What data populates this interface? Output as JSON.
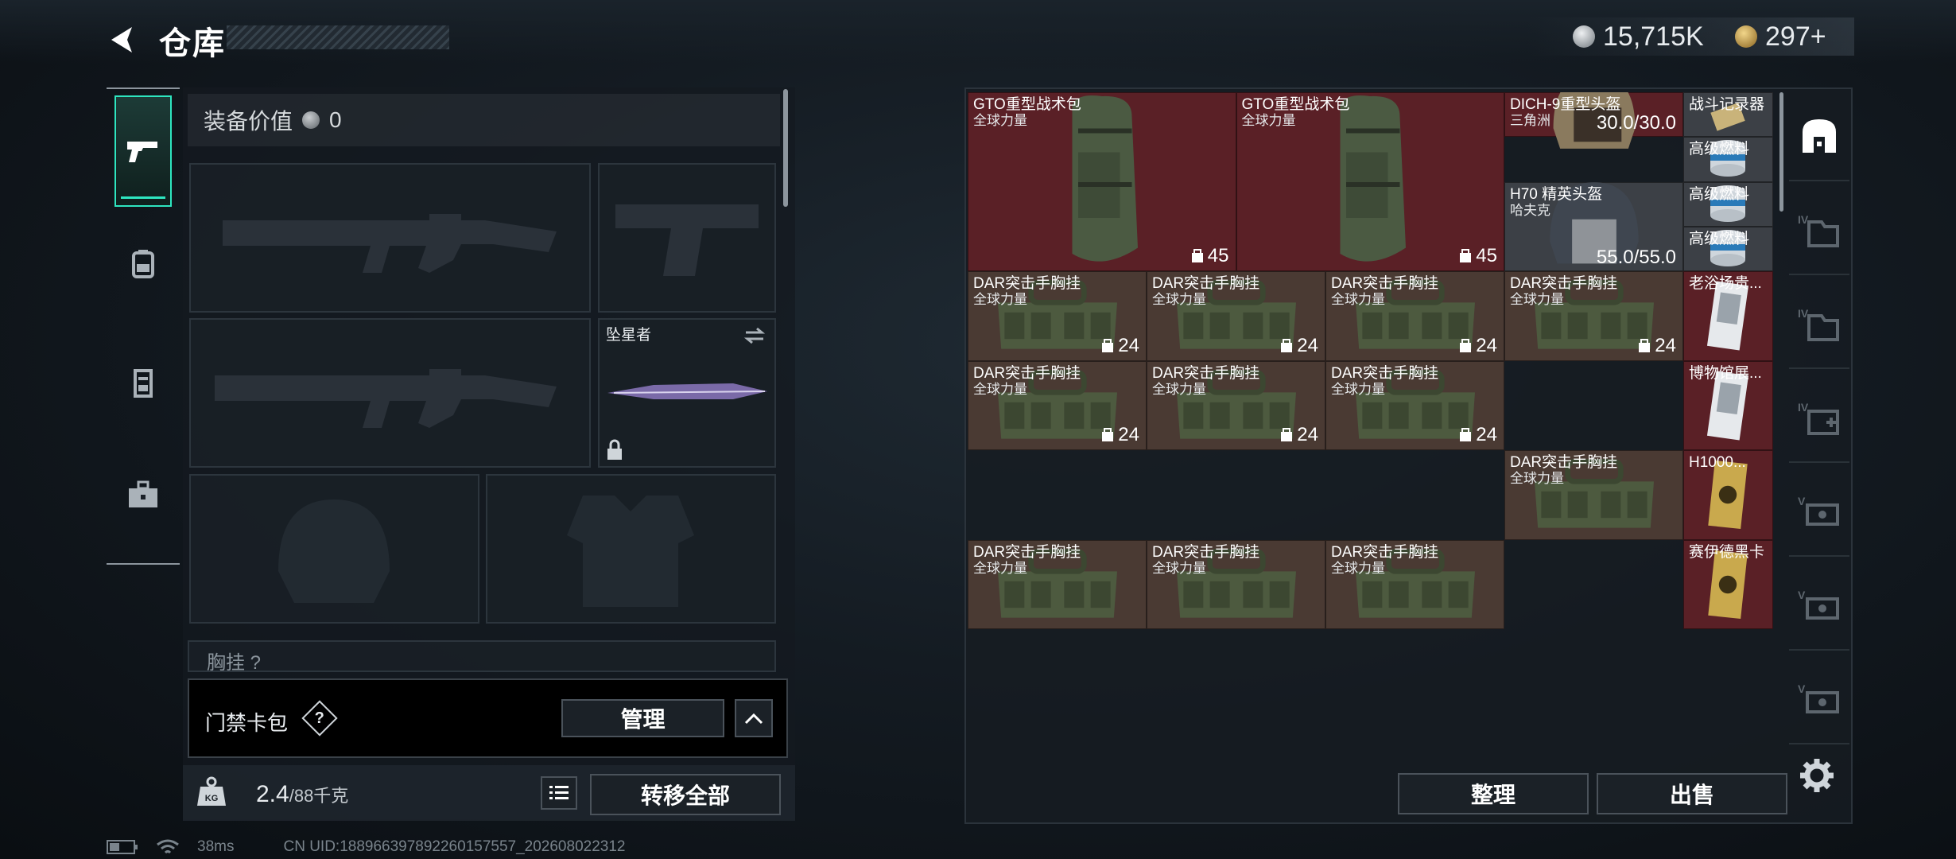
{
  "header": {
    "title": "仓库"
  },
  "currency": [
    {
      "icon": "silver-coin-icon",
      "value": "15,715K",
      "color": "#b7bcc1"
    },
    {
      "icon": "gold-coin-icon",
      "value": "297+",
      "color": "#c9a24b"
    }
  ],
  "left_nav": [
    {
      "icon": "pistol-icon",
      "active": true
    },
    {
      "icon": "backpack-icon",
      "active": false
    },
    {
      "icon": "vest-icon",
      "active": false
    },
    {
      "icon": "briefcase-icon",
      "active": false
    }
  ],
  "loadout": {
    "value_label": "装备价值",
    "value": "0",
    "melee_name": "坠星者",
    "partial_label": "胸挂 ?"
  },
  "keycard": {
    "label": "门禁卡包",
    "help": "?",
    "manage": "管理"
  },
  "footer": {
    "weight": "2.4",
    "weight_max": "/88千克",
    "move_all": "转移全部"
  },
  "status": {
    "ping": "38ms",
    "uid": "CN UID:1889663978922601575​57_202608022312"
  },
  "inventory": {
    "items": [
      {
        "name": "GTO重型战术包",
        "sub": "全球力量",
        "count": "45",
        "color": "red"
      },
      {
        "name": "GTO重型战术包",
        "sub": "全球力量",
        "count": "45",
        "color": "red"
      },
      {
        "name": "DICH-9重型头盔",
        "sub": "三角洲",
        "durability": "30.0/30.0",
        "color": "red"
      },
      {
        "name": "战斗记录器",
        "color": "gry"
      },
      {
        "name": "高级燃料",
        "color": "gry"
      },
      {
        "name": "H70 精英头盔",
        "sub": "哈夫克",
        "durability": "55.0/55.0",
        "color": "gry"
      },
      {
        "name": "高级燃料",
        "color": "gry"
      },
      {
        "name": "高级燃料",
        "color": "gry"
      },
      {
        "name": "DAR突击手胸挂",
        "sub": "全球力量",
        "count": "24",
        "color": "brn"
      },
      {
        "name": "DAR突击手胸挂",
        "sub": "全球力量",
        "count": "24",
        "color": "brn"
      },
      {
        "name": "DAR突击手胸挂",
        "sub": "全球力量",
        "count": "24",
        "color": "brn"
      },
      {
        "name": "DAR突击手胸挂",
        "sub": "全球力量",
        "count": "24",
        "color": "brn"
      },
      {
        "name": "老浴场贵...",
        "color": "red"
      },
      {
        "name": "DAR突击手胸挂",
        "sub": "全球力量",
        "count": "24",
        "color": "brn"
      },
      {
        "name": "DAR突击手胸挂",
        "sub": "全球力量",
        "count": "24",
        "color": "brn"
      },
      {
        "name": "DAR突击手胸挂",
        "sub": "全球力量",
        "count": "24",
        "color": "brn"
      },
      {
        "name": "博物馆展...",
        "color": "red"
      },
      {
        "name": "DAR突击手胸挂",
        "sub": "全球力量",
        "color": "brn"
      },
      {
        "name": "H1000...",
        "color": "red"
      },
      {
        "name": "DAR突击手胸挂",
        "sub": "全球力量",
        "color": "brn"
      },
      {
        "name": "DAR突击手胸挂",
        "sub": "全球力量",
        "color": "brn"
      },
      {
        "name": "DAR突击手胸挂",
        "sub": "全球力量",
        "color": "brn"
      },
      {
        "name": "赛伊德黑卡",
        "color": "red"
      }
    ]
  },
  "right_nav": [
    "safe-icon",
    "warehouse-iv-1-icon",
    "warehouse-iv-2-icon",
    "warehouse-iv-add-icon",
    "cash-1-icon",
    "cash-2-icon",
    "cash-3-icon"
  ],
  "actions": {
    "sort": "整理",
    "sell": "出售"
  }
}
